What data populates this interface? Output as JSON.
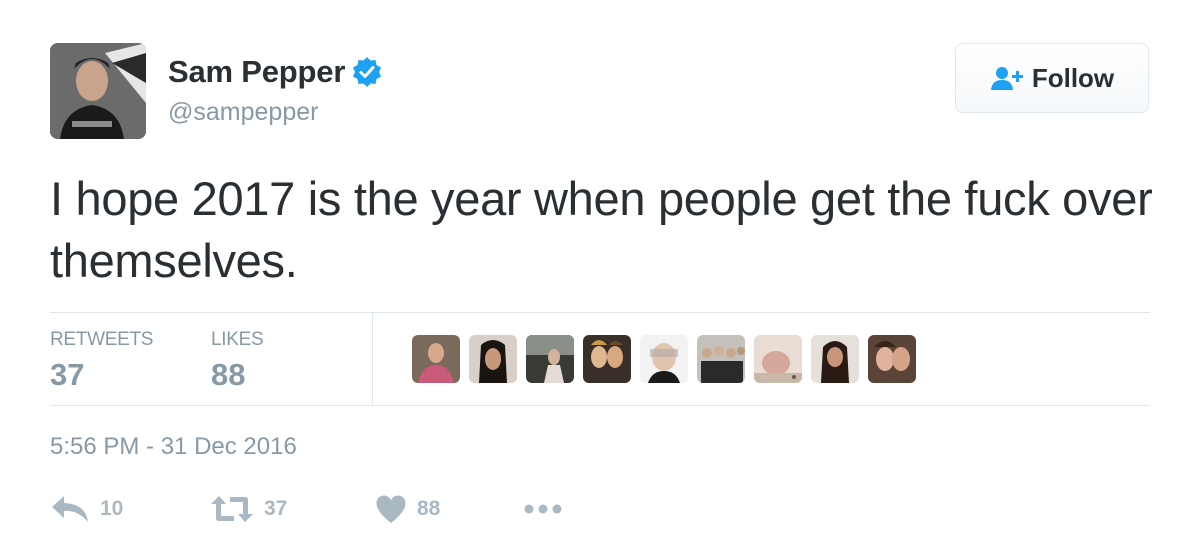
{
  "user": {
    "name": "Sam Pepper",
    "handle": "@sampepper",
    "verified": true
  },
  "follow_button": {
    "label": "Follow",
    "icon": "follow-user-icon"
  },
  "tweet": {
    "text": "I hope 2017 is the year when people get the fuck over themselves.",
    "timestamp": "5:56 PM - 31 Dec 2016"
  },
  "stats": {
    "retweets_label": "RETWEETS",
    "retweets_count": "37",
    "likes_label": "LIKES",
    "likes_count": "88"
  },
  "likers_count_shown": 9,
  "actions": {
    "reply_count": "10",
    "retweet_count": "37",
    "like_count": "88"
  },
  "colors": {
    "text": "#292f33",
    "muted": "#8899a6",
    "action_gray": "#aab8c2",
    "verified_blue": "#1da1f2",
    "border": "#e1e8ed"
  }
}
